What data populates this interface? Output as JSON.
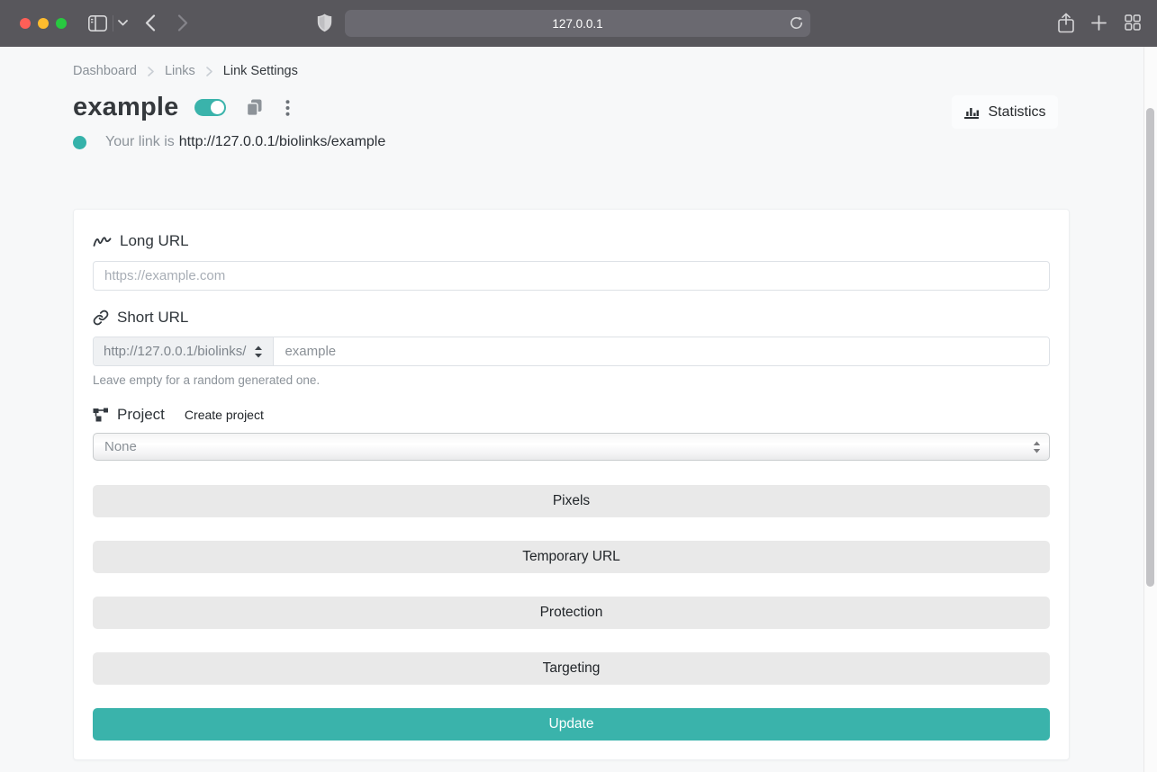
{
  "browser": {
    "url": "127.0.0.1"
  },
  "breadcrumb": {
    "items": [
      "Dashboard",
      "Links",
      "Link Settings"
    ]
  },
  "header": {
    "title": "example",
    "statistics_button": "Statistics"
  },
  "link_status": {
    "label": "Your link is",
    "url": "http://127.0.0.1/biolinks/example"
  },
  "form": {
    "long_url": {
      "label": "Long URL",
      "placeholder": "https://example.com"
    },
    "short_url": {
      "label": "Short URL",
      "domain_option": "http://127.0.0.1/biolinks/",
      "value": "example",
      "help": "Leave empty for a random generated one."
    },
    "project": {
      "label": "Project",
      "create_label": "Create project",
      "selected_option": "None"
    },
    "section_buttons": [
      "Pixels",
      "Temporary URL",
      "Protection",
      "Targeting"
    ],
    "update_label": "Update"
  },
  "colors": {
    "accent_teal": "#3ab3ab",
    "section_button_bg": "#e9e9e9",
    "toolbar_bg": "#58575c"
  }
}
